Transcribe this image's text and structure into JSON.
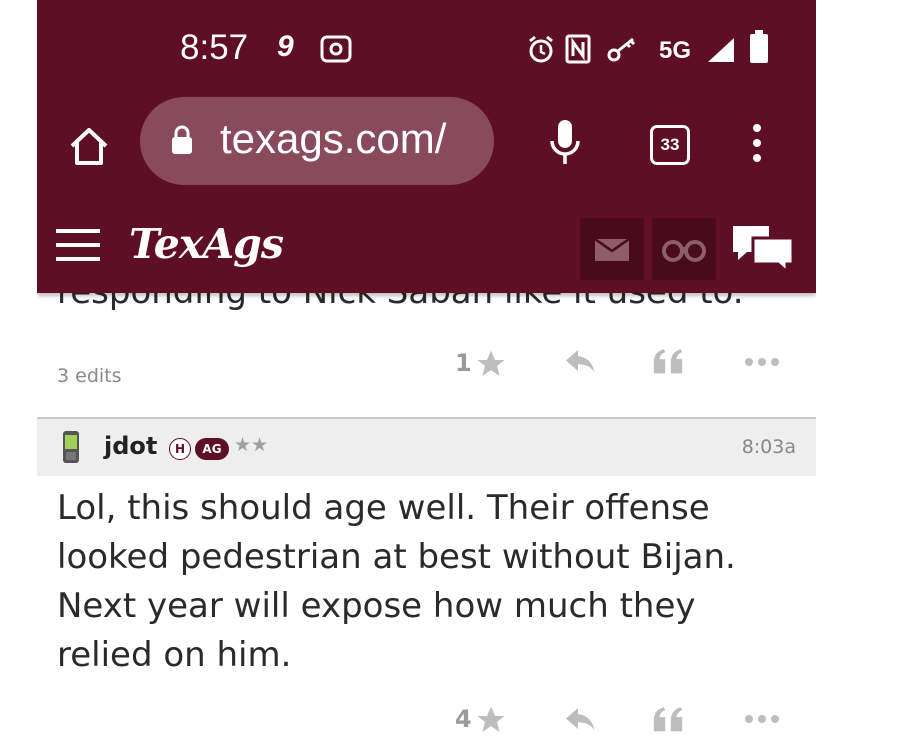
{
  "status_bar": {
    "time": "8:57",
    "notification_glyph": "9",
    "network": "5G",
    "icons": [
      "radio-icon",
      "alarm-icon",
      "nfc-icon",
      "vpn-key-icon",
      "signal-icon",
      "battery-icon"
    ]
  },
  "browser": {
    "url": "texags.com/",
    "tab_count": "33",
    "icons": [
      "home-icon",
      "lock-icon",
      "mic-icon",
      "tabs-icon",
      "more-vert-icon"
    ]
  },
  "site_header": {
    "logo": "TexAgs",
    "icons": [
      "menu-icon",
      "mail-icon",
      "binoculars-icon",
      "chat-icon"
    ]
  },
  "previous_post": {
    "partial_text": "responding to Nick Saban like it used to.",
    "edits": "3 edits",
    "star_count": "1"
  },
  "post": {
    "username": "jdot",
    "badge_h": "H",
    "badge_ag": "AG",
    "stars": "★★",
    "time": "8:03a",
    "body": "Lol, this should age well. Their offense looked pedestrian at best without Bijan. Next year will expose how much they relied on him.",
    "star_count": "4"
  },
  "colors": {
    "brand": "#5e0e25",
    "omnibox": "#8a4a5d",
    "header_bg": "#eeeeee"
  }
}
